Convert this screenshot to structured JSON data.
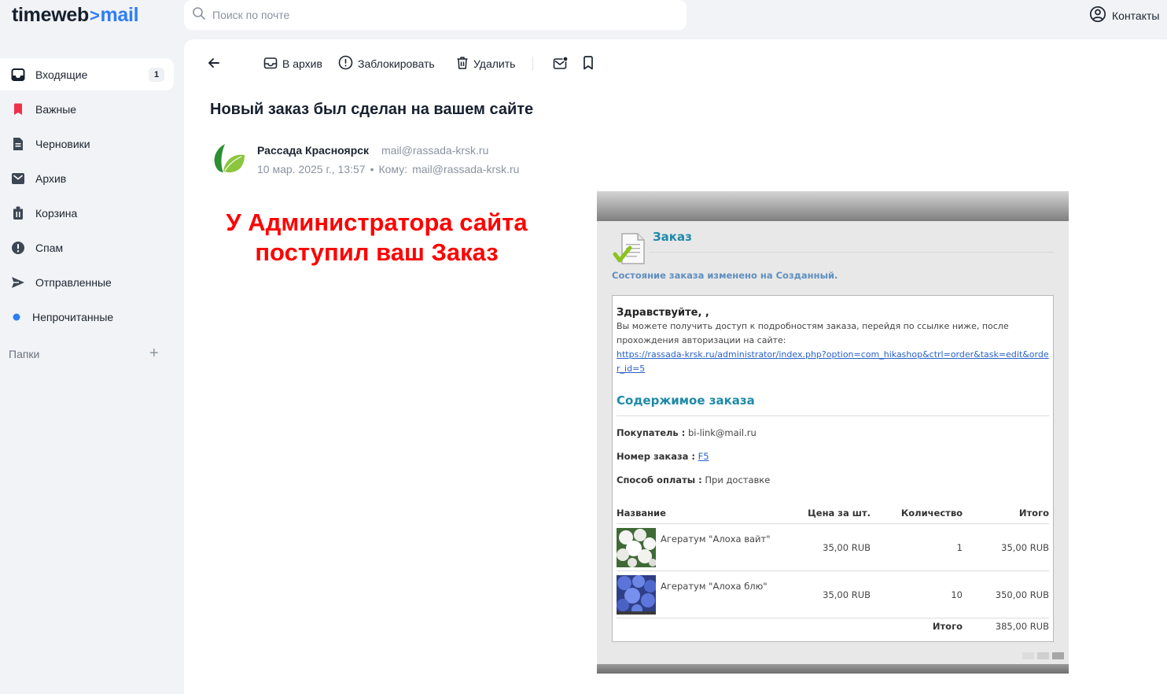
{
  "app": {
    "logo_brand": "timeweb",
    "logo_separator": ">",
    "logo_product": "mail",
    "accent_color": "#2f7df6"
  },
  "search": {
    "placeholder": "Поиск по почте"
  },
  "header": {
    "contacts_label": "Контакты"
  },
  "sidebar": {
    "items": [
      {
        "label": "Входящие",
        "icon": "inbox-icon",
        "count": "1",
        "active": true
      },
      {
        "label": "Важные",
        "icon": "bookmark-icon"
      },
      {
        "label": "Черновики",
        "icon": "draft-icon"
      },
      {
        "label": "Архив",
        "icon": "archive-icon"
      },
      {
        "label": "Корзина",
        "icon": "trash-icon"
      },
      {
        "label": "Спам",
        "icon": "spam-icon"
      },
      {
        "label": "Отправленные",
        "icon": "send-icon"
      },
      {
        "label": "Непрочитанные",
        "icon": "unread-dot-icon"
      }
    ],
    "folders_label": "Папки",
    "add_folder_symbol": "+"
  },
  "toolbar": {
    "archive_label": "В архив",
    "block_label": "Заблокировать",
    "delete_label": "Удалить"
  },
  "message": {
    "subject": "Новый заказ был сделан на вашем сайте",
    "sender_name": "Рассада Красноярск",
    "sender_email": "mail@rassada-krsk.ru",
    "date": "10 мар. 2025 г., 13:57",
    "separator": "•",
    "to_label": "Кому:",
    "to_email": "mail@rassada-krsk.ru"
  },
  "annotation": {
    "line1": "У Администратора сайта",
    "line2": "поступил ваш Заказ"
  },
  "email_body": {
    "order_title": "Заказ",
    "status_text": "Состояние заказа изменено на Созданный.",
    "greeting": "Здравствуйте, ,",
    "intro": "Вы можете получить доступ к подробностям заказа, перейдя по ссылке ниже, после прохождения авторизации на сайте:",
    "link": "https://rassada-krsk.ru/administrator/index.php?option=com_hikashop&ctrl=order&task=edit&order_id=5",
    "content_heading": "Содержимое заказа",
    "buyer_label": "Покупатель :",
    "buyer_value": "bi-link@mail.ru",
    "order_number_label": "Номер заказа :",
    "order_number_value": "F5",
    "payment_label": "Способ оплаты :",
    "payment_value": "При доставке",
    "columns": [
      "Название",
      "Цена за шт.",
      "Количество",
      "Итого"
    ],
    "items": [
      {
        "name": "Агератум \"Алоха вайт\"",
        "price": "35,00 RUB",
        "qty": "1",
        "total": "35,00 RUB",
        "thumb_color": "white"
      },
      {
        "name": "Агератум \"Алоха блю\"",
        "price": "35,00 RUB",
        "qty": "10",
        "total": "350,00 RUB",
        "thumb_color": "blue"
      }
    ],
    "grand_total_label": "Итого",
    "grand_total_value": "385,00 RUB"
  }
}
